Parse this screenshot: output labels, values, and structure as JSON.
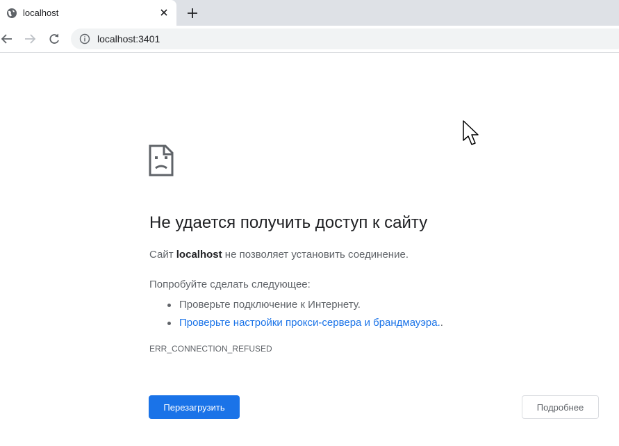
{
  "colors": {
    "accent": "#1a73e8",
    "tabstrip": "#dee1e6",
    "omnibox": "#f1f3f4",
    "text_primary": "#202124",
    "text_secondary": "#5f6368"
  },
  "tab": {
    "title": "localhost",
    "favicon": "globe-icon",
    "close_icon": "close-icon"
  },
  "new_tab_icon": "plus-icon",
  "toolbar": {
    "back_icon": "arrow-left-icon",
    "forward_icon": "arrow-right-icon",
    "reload_icon": "reload-icon",
    "site_info_icon": "info-icon",
    "url": "localhost:3401"
  },
  "error": {
    "icon": "sad-page-icon",
    "heading": "Не удается получить доступ к сайту",
    "summary_prefix": "Сайт ",
    "summary_host": "localhost",
    "summary_suffix": " не позволяет установить соединение.",
    "suggestions_title": "Попробуйте сделать следующее:",
    "suggestions": [
      "Проверьте подключение к Интернету.",
      "Проверьте настройки прокси-сервера и брандмауэра."
    ],
    "suggestion_link_trailing": ".",
    "code": "ERR_CONNECTION_REFUSED"
  },
  "buttons": {
    "reload": "Перезагрузить",
    "details": "Подробнее"
  }
}
